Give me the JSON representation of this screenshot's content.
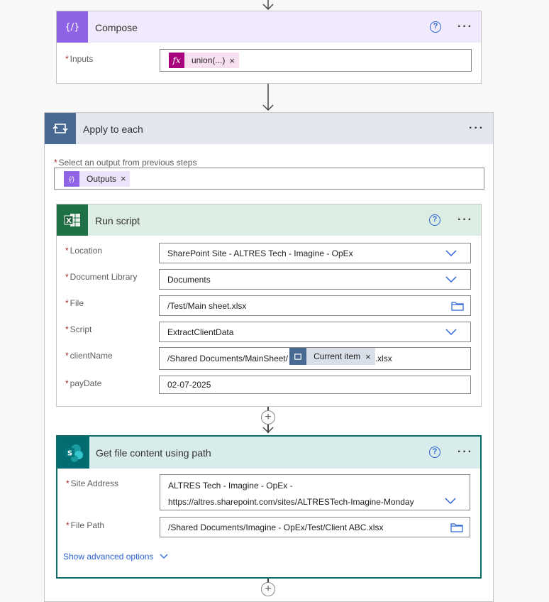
{
  "compose": {
    "title": "Compose",
    "inputs_label": "Inputs",
    "inputs_token": "union(...)",
    "token_remove": "×",
    "help": "?",
    "more": "···"
  },
  "apply": {
    "title": "Apply to each",
    "select_label": "Select an output from previous steps",
    "outputs_token": "Outputs",
    "token_remove": "×",
    "more": "···"
  },
  "run_script": {
    "title": "Run script",
    "help": "?",
    "more": "···",
    "location_label": "Location",
    "location_value": "SharePoint Site - ALTRES Tech - Imagine -  OpEx",
    "library_label": "Document Library",
    "library_value": "Documents",
    "file_label": "File",
    "file_value": "/Test/Main sheet.xlsx",
    "script_label": "Script",
    "script_value": "ExtractClientData",
    "client_label": "clientName",
    "client_prefix": "/Shared Documents/MainSheet/",
    "client_token": "Current item",
    "client_suffix": ".xlsx",
    "paydate_label": "payDate",
    "paydate_value": "02-07-2025",
    "token_remove": "×"
  },
  "get_file": {
    "title": "Get file content using path",
    "help": "?",
    "more": "···",
    "site_label": "Site Address",
    "site_line1": "ALTRES Tech - Imagine -  OpEx -",
    "site_line2": "https://altres.sharepoint.com/sites/ALTRESTech-Imagine-Monday",
    "path_label": "File Path",
    "path_value": "/Shared Documents/Imagine -  OpEx/Test/Client ABC.xlsx",
    "advanced": "Show advanced options"
  },
  "required_mark": "*",
  "add_step": "+"
}
